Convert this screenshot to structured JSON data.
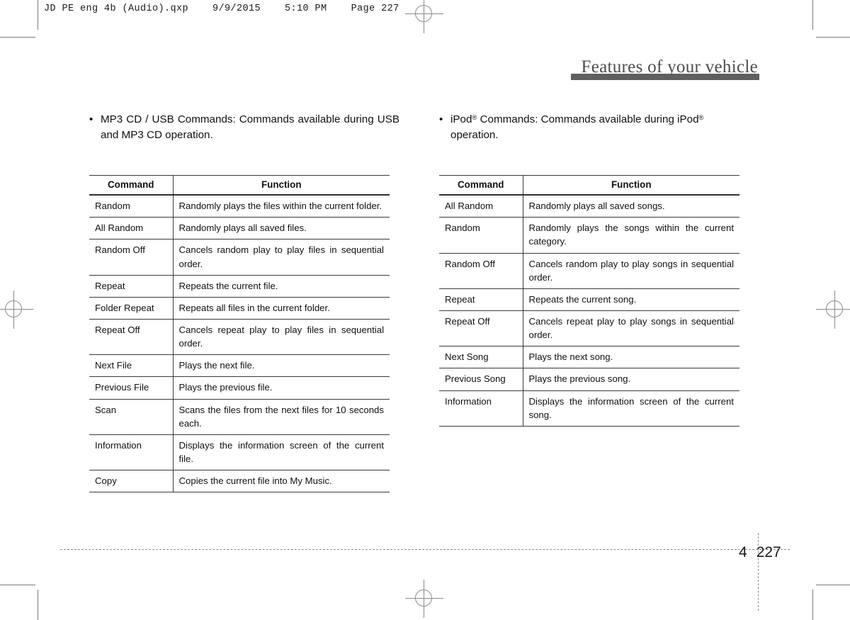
{
  "print_marks": {
    "file_stamp": "JD PE eng 4b (Audio).qxp    9/9/2015    5:10 PM    Page 227"
  },
  "header": {
    "section_title": "Features of your vehicle"
  },
  "footer": {
    "chapter_number": "4",
    "page_number": "227"
  },
  "columns": {
    "left": {
      "intro": {
        "bullet": "•",
        "text_before": "MP3 CD / USB Commands: Commands available during USB and MP3 CD operation."
      },
      "table": {
        "headers": {
          "command": "Command",
          "function": "Function"
        },
        "rows": [
          {
            "command": "Random",
            "function": "Randomly plays the files within the current folder."
          },
          {
            "command": "All Random",
            "function": "Randomly plays all saved files."
          },
          {
            "command": "Random Off",
            "function": "Cancels random play to play files in sequential order."
          },
          {
            "command": "Repeat",
            "function": "Repeats the current file."
          },
          {
            "command": "Folder Repeat",
            "function": "Repeats all files in the current folder."
          },
          {
            "command": "Repeat Off",
            "function": "Cancels repeat play to play files in sequential order."
          },
          {
            "command": "Next File",
            "function": "Plays the next file."
          },
          {
            "command": "Previous File",
            "function": "Plays the previous file."
          },
          {
            "command": "Scan",
            "function": "Scans the files from the next files for 10 seconds each."
          },
          {
            "command": "Information",
            "function": "Displays the information screen of the current file."
          },
          {
            "command": "Copy",
            "function": "Copies the current file into My Music."
          }
        ]
      }
    },
    "right": {
      "intro": {
        "bullet": "•",
        "product": "iPod",
        "registered_mark": "®",
        "text_middle": " Commands: Commands available during iPod",
        "text_end": " operation."
      },
      "table": {
        "headers": {
          "command": "Command",
          "function": "Function"
        },
        "rows": [
          {
            "command": "All Random",
            "function": "Randomly plays all saved songs."
          },
          {
            "command": "Random",
            "function": "Randomly plays the songs within the current category."
          },
          {
            "command": "Random Off",
            "function": "Cancels random play to play songs in sequential order."
          },
          {
            "command": "Repeat",
            "function": "Repeats the current song."
          },
          {
            "command": "Repeat Off",
            "function": "Cancels repeat play to play songs in sequential order."
          },
          {
            "command": "Next Song",
            "function": "Plays the next song."
          },
          {
            "command": "Previous Song",
            "function": "Plays the previous song."
          },
          {
            "command": "Information",
            "function": "Displays the information screen of the current song."
          }
        ]
      }
    }
  }
}
